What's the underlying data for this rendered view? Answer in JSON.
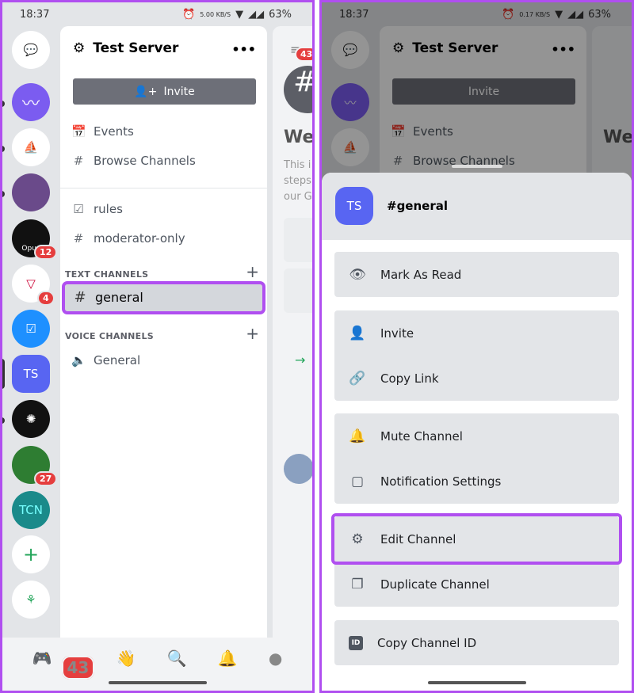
{
  "status": {
    "time": "18:37",
    "net_speed": "5.00 KB/S",
    "net_speed_2": "0.17 KB/S",
    "battery": "63%"
  },
  "server": {
    "name": "Test Server",
    "more": "•••",
    "invite": "Invite"
  },
  "channels": {
    "events": "Events",
    "browse": "Browse Channels",
    "rules": "rules",
    "moderator": "moderator-only",
    "text_category": "TEXT CHANNELS",
    "general": "general",
    "voice_category": "VOICE CHANNELS",
    "voice_general": "General"
  },
  "servers": [
    {
      "label": ""
    },
    {
      "label": ""
    },
    {
      "label": ""
    },
    {
      "label": "Opus",
      "badge": "12"
    },
    {
      "label": "",
      "badge": "4"
    },
    {
      "label": ""
    },
    {
      "label": "TS"
    },
    {
      "label": ""
    },
    {
      "label": "",
      "badge": "27"
    },
    {
      "label": "TCN"
    }
  ],
  "preview": {
    "badge": "43",
    "title": "We",
    "text1": "This i",
    "text2": "steps",
    "text3": "our G"
  },
  "nav": {
    "home_badge": "43"
  },
  "sheet": {
    "avatar": "TS",
    "title": "#general",
    "items": [
      "Mark As Read",
      "Invite",
      "Copy Link",
      "Mute Channel",
      "Notification Settings",
      "Edit Channel",
      "Duplicate Channel",
      "Copy Channel ID"
    ],
    "id_icon": "ID"
  },
  "colors": {
    "accent": "#5865f2",
    "highlight": "#b04ff0",
    "badge": "#e53e3e"
  }
}
